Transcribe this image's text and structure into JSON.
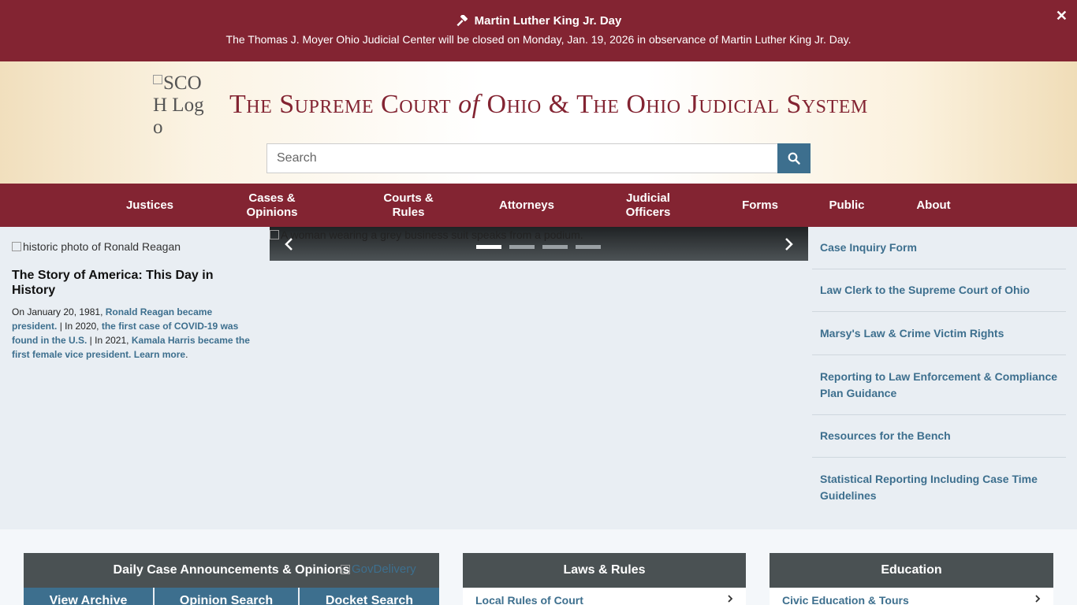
{
  "alert": {
    "title": "Martin Luther King Jr. Day",
    "message": "The Thomas J. Moyer Ohio Judicial Center will be closed on Monday, Jan. 19, 2026 in observance of Martin Luther King Jr. Day.",
    "close_label": "✕"
  },
  "header": {
    "logo_alt": "SCOH Logo",
    "title_part1": "The Supreme Court",
    "title_of": "of",
    "title_part2": "Ohio & The Ohio Judicial System",
    "search_placeholder": "Search"
  },
  "nav": {
    "items": [
      {
        "label": "Justices"
      },
      {
        "label": "Cases & Opinions"
      },
      {
        "label": "Courts & Rules"
      },
      {
        "label": "Attorneys"
      },
      {
        "label": "Judicial Officers"
      },
      {
        "label": "Forms"
      },
      {
        "label": "Public"
      },
      {
        "label": "About"
      }
    ]
  },
  "feature": {
    "image_alt": "historic photo of Ronald Reagan",
    "title": "The Story of America: This Day in History",
    "t1": "On January 20, 1981, ",
    "l1": "Ronald Reagan became president.",
    "t2": " | In 2020, ",
    "l2": "the first case of COVID-19 was found in the U.S.",
    "t3": " | In 2021, ",
    "l3": "Kamala Harris became the first female vice president.",
    "t4": " ",
    "l4": "Learn more",
    "t5": "."
  },
  "carousel": {
    "image_alt": "A woman wearing a grey business suit speaks from a podium.",
    "slide_count": 4,
    "active_slide": 1
  },
  "quick_links": [
    "Case Inquiry Form",
    "Law Clerk to the Supreme Court of Ohio",
    "Marsy's Law & Crime Victim Rights",
    "Reporting to Law Enforcement & Compliance Plan Guidance",
    "Resources for the Bench",
    "Statistical Reporting Including Case Time Guidelines"
  ],
  "panels": {
    "announcements": {
      "title": "Daily Case Announcements & Opinions",
      "gov_alt": "GovDelivery",
      "buttons": [
        "View Archive",
        "Opinion Search",
        "Docket Search"
      ]
    },
    "laws": {
      "title": "Laws & Rules",
      "first_item": "Local Rules of Court"
    },
    "education": {
      "title": "Education",
      "first_item": "Civic Education & Tours"
    }
  },
  "colors": {
    "maroon": "#832432",
    "accent_blue": "#3d6f8e",
    "panel_gray": "#4a5153"
  },
  "icons": {
    "alert": "gavel-icon",
    "search": "magnifier-icon",
    "prev": "chevron-left-icon",
    "next": "chevron-right-icon",
    "list": "chevron-right-icon"
  }
}
